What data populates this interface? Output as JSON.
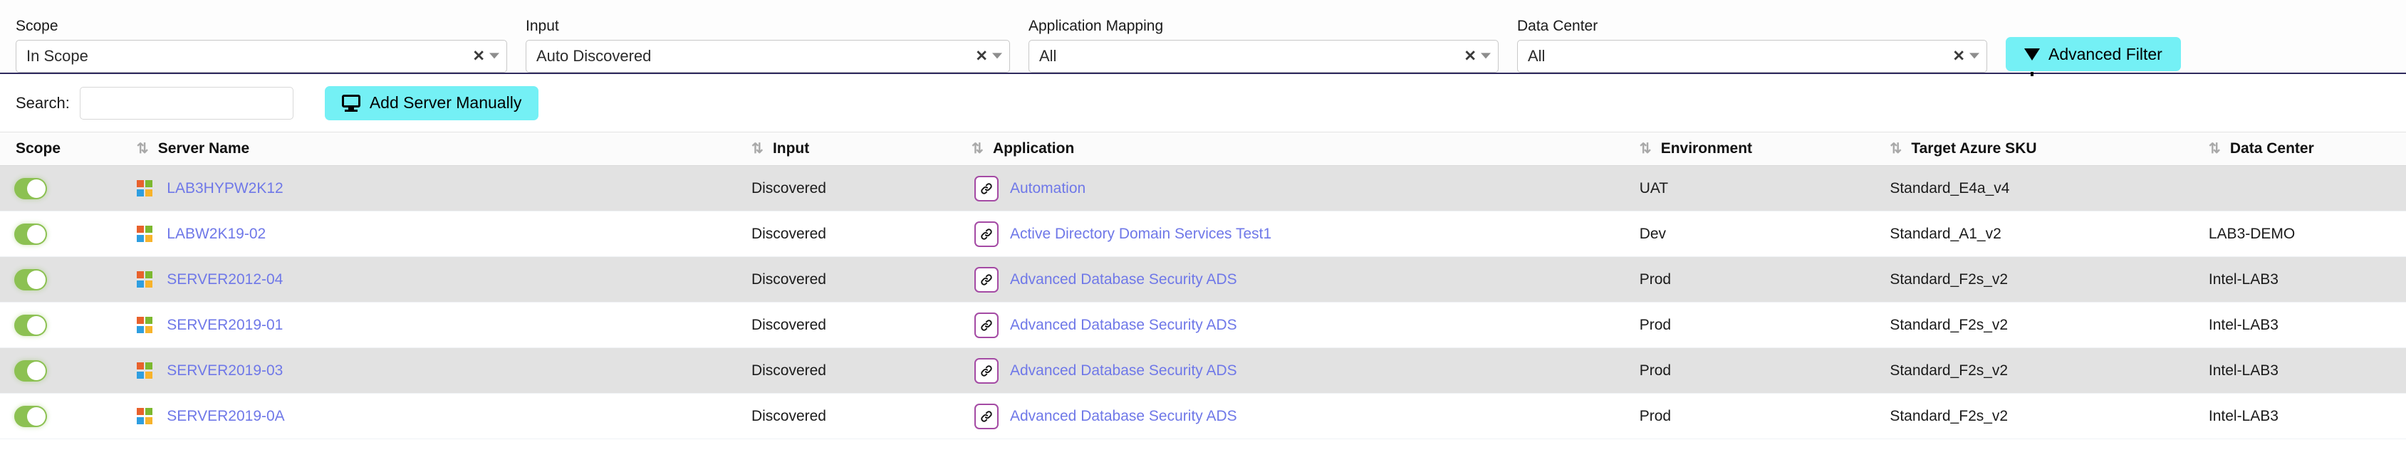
{
  "filters": [
    {
      "label": "Scope",
      "value": "In Scope",
      "clear": "✕",
      "group_class": "g-scope",
      "name": "scope"
    },
    {
      "label": "Input",
      "value": "Auto Discovered",
      "clear": "✕",
      "group_class": "g-input",
      "name": "input"
    },
    {
      "label": "Application Mapping",
      "value": "All",
      "clear": "✕",
      "group_class": "g-appmap",
      "name": "application-mapping"
    },
    {
      "label": "Data Center",
      "value": "All",
      "clear": "✕",
      "group_class": "g-dc",
      "name": "data-center"
    }
  ],
  "filter_labels": {
    "scope": "Scope",
    "input": "Input",
    "application_mapping": "Application Mapping",
    "data_center": "Data Center"
  },
  "filter_values": {
    "scope": "In Scope",
    "input": "Auto Discovered",
    "application_mapping": "All",
    "data_center": "All"
  },
  "advanced_filter_button": "Advanced Filter",
  "search": {
    "label": "Search:",
    "value": "",
    "placeholder": ""
  },
  "add_server_button": "Add Server Manually",
  "table": {
    "columns": [
      {
        "key": "scope",
        "label": "Scope",
        "sortable": false
      },
      {
        "key": "server_name",
        "label": "Server Name",
        "sortable": true
      },
      {
        "key": "input",
        "label": "Input",
        "sortable": true
      },
      {
        "key": "application",
        "label": "Application",
        "sortable": true
      },
      {
        "key": "environment",
        "label": "Environment",
        "sortable": true
      },
      {
        "key": "target_azure_sku",
        "label": "Target Azure SKU",
        "sortable": true
      },
      {
        "key": "data_center",
        "label": "Data Center",
        "sortable": true
      }
    ],
    "rows": [
      {
        "scope_enabled": true,
        "os": "windows",
        "server_name": "LAB3HYPW2K12",
        "input": "Discovered",
        "application": "Automation",
        "environment": "UAT",
        "target_azure_sku": "Standard_E4a_v4",
        "data_center": ""
      },
      {
        "scope_enabled": true,
        "os": "windows",
        "server_name": "LABW2K19-02",
        "input": "Discovered",
        "application": "Active Directory Domain Services Test1",
        "environment": "Dev",
        "target_azure_sku": "Standard_A1_v2",
        "data_center": "LAB3-DEMO"
      },
      {
        "scope_enabled": true,
        "os": "windows",
        "server_name": "SERVER2012-04",
        "input": "Discovered",
        "application": "Advanced Database Security ADS",
        "environment": "Prod",
        "target_azure_sku": "Standard_F2s_v2",
        "data_center": "Intel-LAB3"
      },
      {
        "scope_enabled": true,
        "os": "windows",
        "server_name": "SERVER2019-01",
        "input": "Discovered",
        "application": "Advanced Database Security ADS",
        "environment": "Prod",
        "target_azure_sku": "Standard_F2s_v2",
        "data_center": "Intel-LAB3"
      },
      {
        "scope_enabled": true,
        "os": "windows",
        "server_name": "SERVER2019-03",
        "input": "Discovered",
        "application": "Advanced Database Security ADS",
        "environment": "Prod",
        "target_azure_sku": "Standard_F2s_v2",
        "data_center": "Intel-LAB3"
      },
      {
        "scope_enabled": true,
        "os": "windows",
        "server_name": "SERVER2019-0A",
        "input": "Discovered",
        "application": "Advanced Database Security ADS",
        "environment": "Prod",
        "target_azure_sku": "Standard_F2s_v2",
        "data_center": "Intel-LAB3"
      }
    ]
  },
  "icons": {
    "sort": "⇅",
    "clear": "✕",
    "link_chip": "🔗",
    "funnel": "filter-funnel-icon",
    "monitor": "monitor-icon",
    "windows": "windows-logo-icon"
  },
  "colors": {
    "accent_cyan": "#74f0f5",
    "link_blue": "#6f78e8",
    "toggle_green": "#8cc152",
    "chip_purple": "#a44aa4",
    "header_rule": "#2f2a5e",
    "row_alt": "#e2e2e2"
  }
}
